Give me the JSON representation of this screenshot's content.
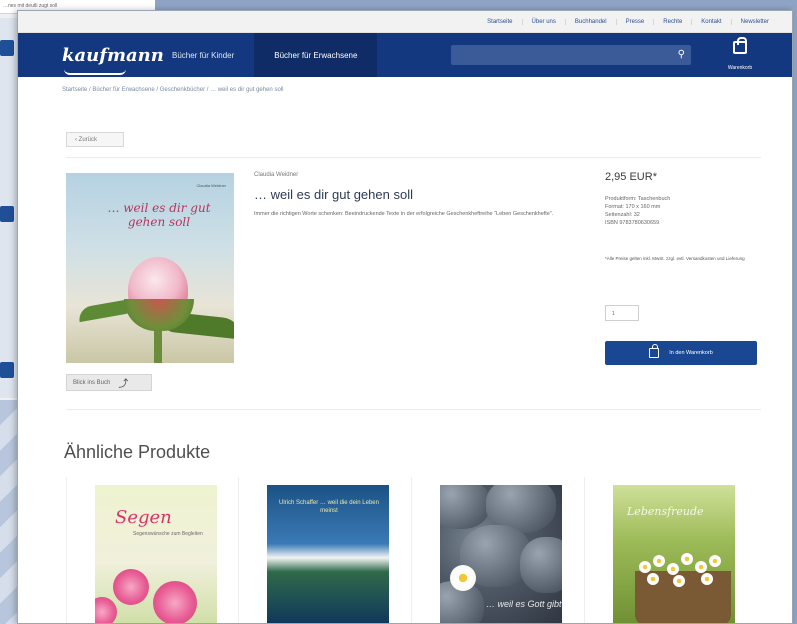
{
  "background_window": {
    "strip_text": "…nes mit deutli zugt soll"
  },
  "topbar": {
    "links": [
      "Startseite",
      "Über uns",
      "Buchhandel",
      "Presse",
      "Rechte",
      "Kontakt",
      "Newsletter"
    ]
  },
  "header": {
    "logo": "kaufmann",
    "nav": [
      "Bücher für Kinder",
      "Bücher für Erwachsene"
    ],
    "active_nav": "Bücher für Erwachsene",
    "search_placeholder": "",
    "cart_label": "Warenkorb"
  },
  "breadcrumb": "Startseite  /  Bücher für Erwachsene  /  Geschenkbücher  /  … weil es dir gut gehen soll",
  "back_label": "‹  Zurück",
  "product": {
    "cover_title": "… weil es dir gut gehen soll",
    "cover_author": "Claudia Weidner",
    "author": "Claudia Weidner",
    "title": "… weil es dir gut gehen soll",
    "description": "Immer die richtigen Worte schenken: Beeindruckende Texte in der erfolgreiche Geschenkheftreihe \"Leben Geschenkhefte\".",
    "look_inside": "Blick ins Buch",
    "price": "2,95 EUR*",
    "specs": [
      "Produktform: Taschenbuch",
      "Format: 170 x 160 mm",
      "Seitenzahl: 32",
      "ISBN 9783780630659"
    ],
    "shipping_note": "*Alle Preise gelten inkl. MwSt. zzgl. evtl. Versandkosten und Lieferung",
    "quantity": "1",
    "add_to_cart": "In den Warenkorb"
  },
  "similar": {
    "heading": "Ähnliche Produkte",
    "items": [
      {
        "cover_title": "Segen",
        "cover_sub": "Segenswünsche zum Begleiten"
      },
      {
        "cover_title": "Ulrich Schaffer … weil die dein Leben meinst"
      },
      {
        "cover_title": "… weil es Gott gibt"
      },
      {
        "cover_title": "Lebensfreude"
      }
    ]
  }
}
